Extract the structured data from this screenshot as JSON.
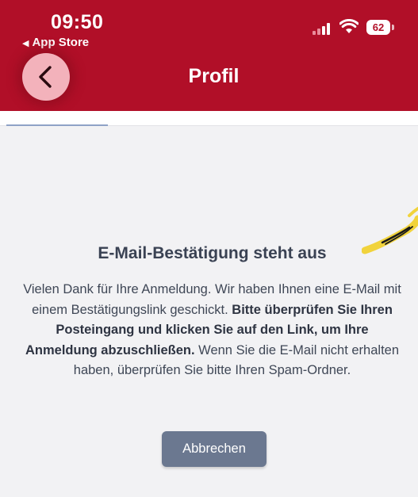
{
  "status_bar": {
    "time": "09:50",
    "back_to_app": "App Store",
    "battery": "62"
  },
  "header": {
    "title": "Profil",
    "back_icon": "chevron-left-icon",
    "background_color": "#b10f28"
  },
  "content": {
    "heading": "E-Mail-Bestätigung steht aus",
    "paragraph_part1": "Vielen Dank für Ihre Anmeldung. Wir haben Ihnen eine E-Mail mit einem Bestätigungslink geschickt. ",
    "paragraph_bold": "Bitte überprüfen Sie Ihren Posteingang und klicken Sie auf den Link, um Ihre Anmeldung abzuschließen.",
    "paragraph_part2": " Wenn Sie die E-Mail nicht erhalten haben, überprüfen Sie bitte Ihren Spam-Ordner.",
    "cancel_label": "Abbrechen"
  }
}
